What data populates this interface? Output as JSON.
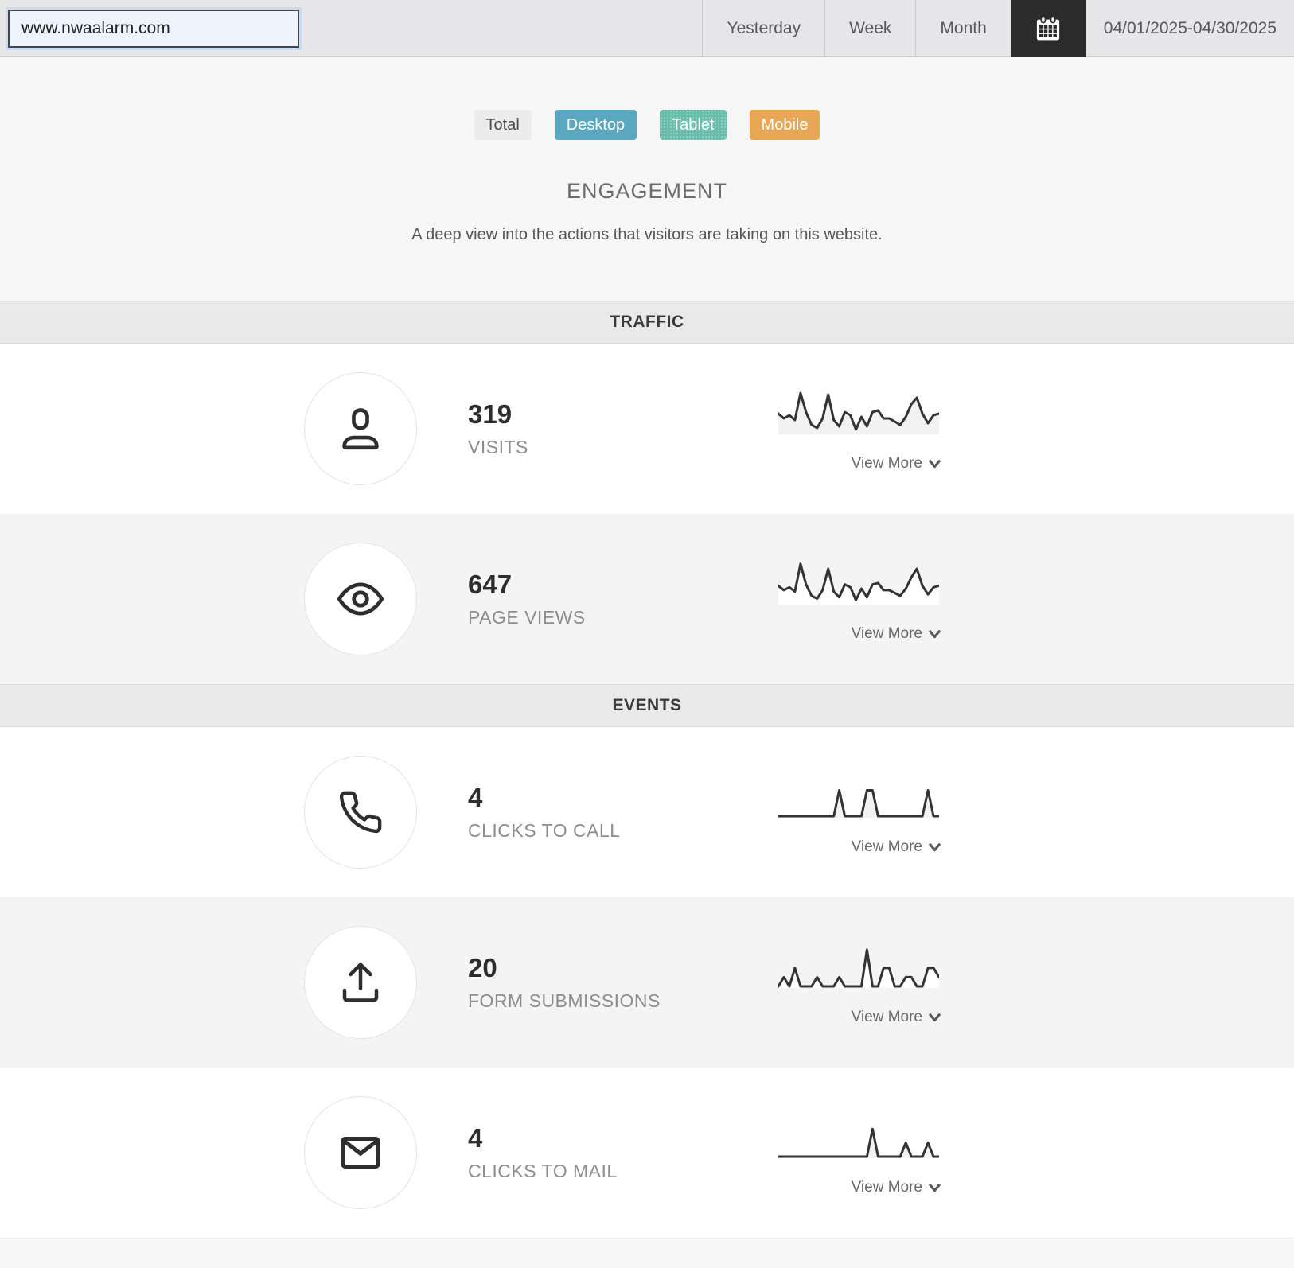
{
  "header": {
    "url_value": "www.nwaalarm.com",
    "range_tabs": [
      {
        "label": "Yesterday"
      },
      {
        "label": "Week"
      },
      {
        "label": "Month"
      }
    ],
    "date_range": "04/01/2025-04/30/2025",
    "calendar_tile_bg": "#2b2b2b"
  },
  "filters": [
    {
      "label": "Total",
      "bg": "#ececec",
      "fg": "#4a4a4a"
    },
    {
      "label": "Desktop",
      "bg": "#5aa7c0",
      "fg": "#ffffff"
    },
    {
      "label": "Tablet",
      "bg": "#68bcab",
      "fg": "#ffffff"
    },
    {
      "label": "Mobile",
      "bg": "#e8a755",
      "fg": "#ffffff"
    }
  ],
  "intro": {
    "title": "ENGAGEMENT",
    "subtitle": "A deep view into the actions that visitors are taking on this website."
  },
  "sections": {
    "traffic": "TRAFFIC",
    "events": "EVENTS"
  },
  "ui": {
    "view_more_label": "View More"
  },
  "metrics": {
    "visits": {
      "value": "319",
      "label": "VISITS",
      "icon": "user-icon"
    },
    "page_views": {
      "value": "647",
      "label": "PAGE VIEWS",
      "icon": "eye-icon"
    },
    "clicks_to_call": {
      "value": "4",
      "label": "CLICKS TO CALL",
      "icon": "phone-icon"
    },
    "form_submissions": {
      "value": "20",
      "label": "FORM SUBMISSIONS",
      "icon": "upload-icon"
    },
    "clicks_to_mail": {
      "value": "4",
      "label": "CLICKS TO MAIL",
      "icon": "mail-icon"
    }
  },
  "chart_data": [
    {
      "name": "visits-daily",
      "type": "line",
      "title": "VISITS sparkline",
      "x_unit": "day",
      "x_range": [
        "04/01/2025",
        "04/30/2025"
      ],
      "values": [
        12,
        9,
        11,
        8,
        25,
        13,
        5,
        3,
        9,
        24,
        8,
        4,
        13,
        11,
        2,
        10,
        4,
        13,
        14,
        9,
        9,
        7,
        5,
        10,
        18,
        22,
        12,
        6,
        11,
        12
      ],
      "total": 319,
      "ylim": [
        0,
        26
      ],
      "grid": false,
      "legend": false
    },
    {
      "name": "page-views-daily",
      "type": "line",
      "title": "PAGE VIEWS sparkline",
      "x_unit": "day",
      "x_range": [
        "04/01/2025",
        "04/30/2025"
      ],
      "values": [
        24,
        18,
        22,
        16,
        55,
        26,
        10,
        6,
        18,
        48,
        16,
        8,
        26,
        22,
        4,
        20,
        8,
        26,
        28,
        18,
        18,
        14,
        10,
        20,
        36,
        48,
        24,
        12,
        22,
        24
      ],
      "total": 647,
      "ylim": [
        0,
        58
      ],
      "grid": false,
      "legend": false
    },
    {
      "name": "clicks-to-call-daily",
      "type": "line",
      "title": "CLICKS TO CALL sparkline",
      "x_unit": "day",
      "x_range": [
        "04/01/2025",
        "04/30/2025"
      ],
      "values": [
        0,
        0,
        0,
        0,
        0,
        0,
        0,
        0,
        0,
        0,
        0,
        1,
        0,
        0,
        0,
        0,
        1,
        1,
        0,
        0,
        0,
        0,
        0,
        0,
        0,
        0,
        0,
        1,
        0,
        0
      ],
      "total": 4,
      "ylim": [
        0,
        1.6
      ],
      "grid": false,
      "legend": false
    },
    {
      "name": "form-submissions-daily",
      "type": "line",
      "title": "FORM SUBMISSIONS sparkline",
      "x_unit": "day",
      "x_range": [
        "04/01/2025",
        "04/30/2025"
      ],
      "values": [
        0,
        1,
        0,
        2,
        0,
        0,
        0,
        1,
        0,
        0,
        0,
        1,
        0,
        0,
        0,
        0,
        4,
        0,
        0,
        2,
        2,
        0,
        0,
        1,
        1,
        0,
        0,
        2,
        2,
        1
      ],
      "total": 20,
      "ylim": [
        0,
        4.5
      ],
      "grid": false,
      "legend": false
    },
    {
      "name": "clicks-to-mail-daily",
      "type": "line",
      "title": "CLICKS TO MAIL sparkline",
      "x_unit": "day",
      "x_range": [
        "04/01/2025",
        "04/30/2025"
      ],
      "values": [
        0,
        0,
        0,
        0,
        0,
        0,
        0,
        0,
        0,
        0,
        0,
        0,
        0,
        0,
        0,
        0,
        0,
        2,
        0,
        0,
        0,
        0,
        0,
        1,
        0,
        0,
        0,
        1,
        0,
        0
      ],
      "total": 4,
      "ylim": [
        0,
        3
      ],
      "grid": false,
      "legend": false
    }
  ]
}
